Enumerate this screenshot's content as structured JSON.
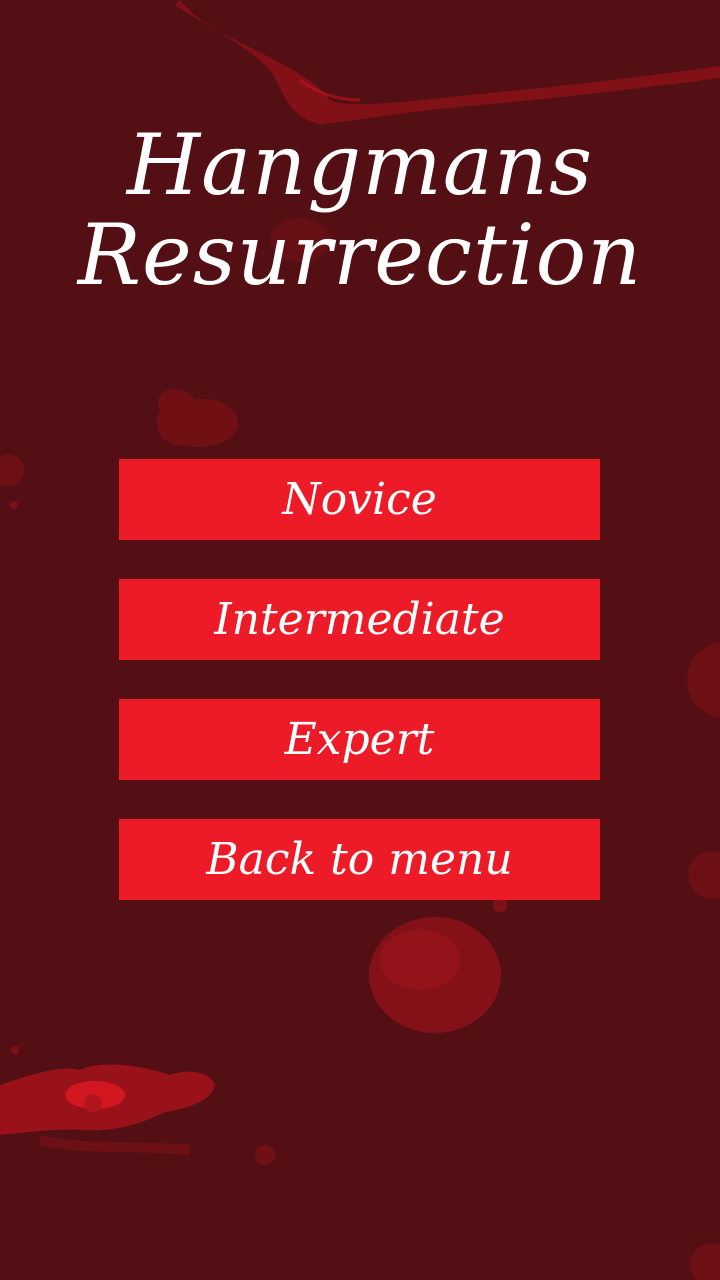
{
  "title": {
    "line1": "Hangmans",
    "line2": "Resurrection"
  },
  "menu": {
    "novice_label": "Novice",
    "intermediate_label": "Intermediate",
    "expert_label": "Expert",
    "back_label": "Back to menu"
  },
  "colors": {
    "background": "#530f13",
    "button": "#ec1b27",
    "text": "#ffffff",
    "blood": "#c0141c"
  }
}
